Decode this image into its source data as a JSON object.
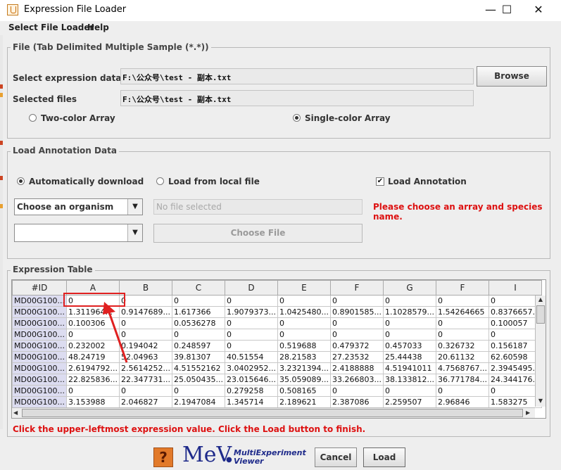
{
  "window": {
    "title": "Expression File Loader",
    "icon": "java-cup-icon",
    "controls": {
      "minimize": "—",
      "maximize": "☐",
      "close": "✕"
    }
  },
  "menu": {
    "items": [
      "Select File Loader",
      "Help"
    ]
  },
  "file_section": {
    "legend": "File   (Tab Delimited Multiple Sample (*.*))",
    "expression_label": "Select expression data file",
    "expression_value": "F:\\公众号\\test - 副本.txt",
    "browse_label": "Browse",
    "selected_label": "Selected files",
    "selected_value": "F:\\公众号\\test - 副本.txt",
    "two_color_label": "Two-color Array",
    "single_color_label": "Single-color Array",
    "selected_array": "Single-color Array"
  },
  "annotation_section": {
    "legend": "Load Annotation Data",
    "auto_download_label": "Automatically download",
    "local_file_label": "Load from local file",
    "load_annotation_label": "Load Annotation",
    "load_annotation_checked": true,
    "organism_placeholder": "Choose an organism",
    "file_placeholder": "No file selected",
    "error_message": "Please choose an array and species name.",
    "choose_file_label": "Choose File",
    "selected_mode": "Automatically download"
  },
  "table_section": {
    "legend": "Expression Table",
    "columns": [
      "#ID",
      "A",
      "B",
      "C",
      "D",
      "E",
      "F",
      "G",
      "F",
      "I"
    ],
    "rows": [
      [
        "MD00G100...",
        "0",
        "0",
        "0",
        "0",
        "0",
        "0",
        "0",
        "0",
        "0"
      ],
      [
        "MD00G100...",
        "1.311964...",
        "0.9147689...",
        "1.617366",
        "1.9079373...",
        "1.0425480...",
        "0.8901585...",
        "1.1028579...",
        "1.54264665",
        "0.8376657..."
      ],
      [
        "MD00G100...",
        "0.100306",
        "0",
        "0.0536278",
        "0",
        "0",
        "0",
        "0",
        "0",
        "0.100057"
      ],
      [
        "MD00G100...",
        "0",
        "0",
        "0",
        "0",
        "0",
        "0",
        "0",
        "0",
        "0"
      ],
      [
        "MD00G100...",
        "0.232002",
        "0.194042",
        "0.248597",
        "0",
        "0.519688",
        "0.479372",
        "0.457033",
        "0.326732",
        "0.156187"
      ],
      [
        "MD00G100...",
        "48.24719",
        "52.04963",
        "39.81307",
        "40.51554",
        "28.21583",
        "27.23532",
        "25.44438",
        "20.61132",
        "62.60598"
      ],
      [
        "MD00G100...",
        "2.6194792...",
        "2.5614252...",
        "4.51552162",
        "3.0402952...",
        "3.2321394...",
        "2.4188888",
        "4.51941011",
        "4.7568767...",
        "2.3945495..."
      ],
      [
        "MD00G100...",
        "22.825836...",
        "22.347731...",
        "25.050435...",
        "23.015646...",
        "35.059089...",
        "33.266803...",
        "38.133812...",
        "36.771784...",
        "24.344176..."
      ],
      [
        "MD00G100...",
        "0",
        "0",
        "0",
        "0.279258",
        "0.508165",
        "0",
        "0",
        "0",
        "0"
      ],
      [
        "MD00G100...",
        "3.153988",
        "2.046827",
        "2.1947084",
        "1.345714",
        "2.189621",
        "2.387086",
        "2.259507",
        "2.96846",
        "1.583275"
      ]
    ],
    "instruction": "Click the upper-leftmost expression value. Click the Load button to finish."
  },
  "footer": {
    "help_icon_text": "?",
    "logo_main": "MeV",
    "logo_sub_1": "MultiExperiment",
    "logo_sub_2": "Viewer",
    "cancel_label": "Cancel",
    "load_label": "Load"
  },
  "colors": {
    "error_red": "#dd1111",
    "annotation_red": "#e02020",
    "id_cell": "#dcdcf0",
    "logo_blue": "#1e2a8a",
    "help_orange": "#e27a2a"
  }
}
